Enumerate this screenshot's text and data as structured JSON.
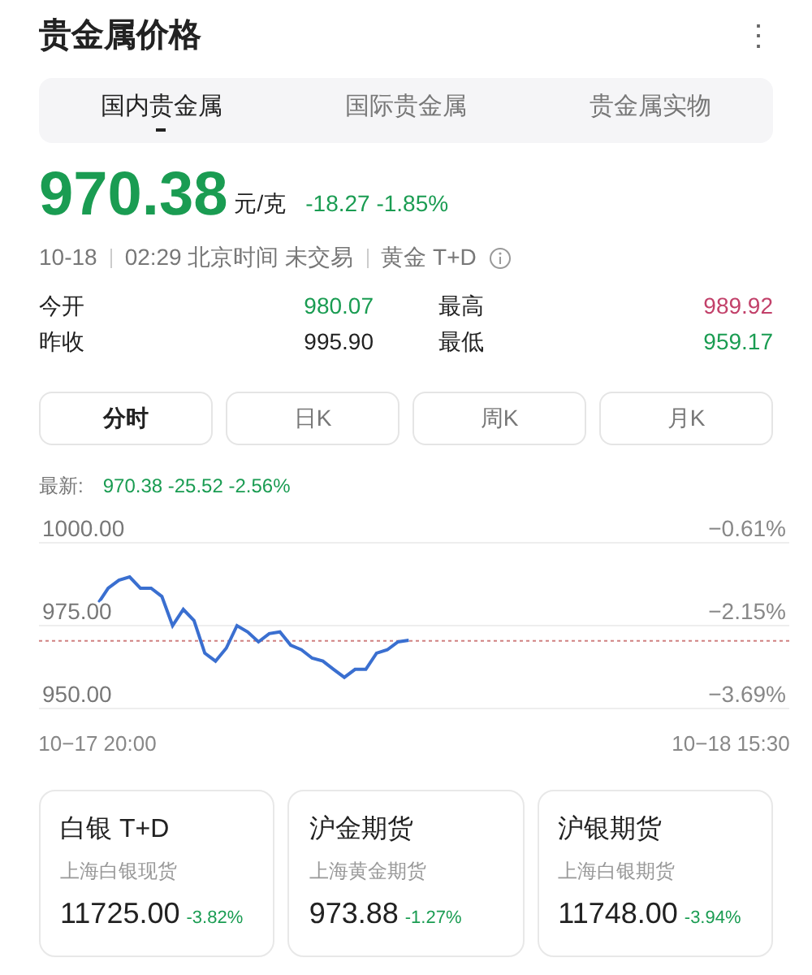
{
  "header": {
    "title": "贵金属价格",
    "menu": "⋮"
  },
  "tabs": [
    {
      "label": "国内贵金属",
      "selected": true
    },
    {
      "label": "国际贵金属",
      "selected": false
    },
    {
      "label": "贵金属实物",
      "selected": false
    }
  ],
  "quote": {
    "price": "970.38",
    "unit": "元/克",
    "change": "-18.27 -1.85%",
    "date": "10-18",
    "time": "02:29 北京时间 未交易",
    "product": "黄金 T+D"
  },
  "stats": [
    {
      "label": "今开",
      "value": "980.07",
      "color": "#1a9c52"
    },
    {
      "label": "最高",
      "value": "989.92",
      "color": "#c2416a"
    },
    {
      "label": "昨收",
      "value": "995.90",
      "color": "#222222"
    },
    {
      "label": "最低",
      "value": "959.17",
      "color": "#1a9c52"
    }
  ],
  "periods": [
    {
      "label": "分时",
      "selected": true
    },
    {
      "label": "日K",
      "selected": false
    },
    {
      "label": "周K",
      "selected": false
    },
    {
      "label": "月K",
      "selected": false
    }
  ],
  "chart": {
    "latest_label": "最新:",
    "latest_value": "970.38 -25.52 -2.56%",
    "right_labels": [
      "−0.61%",
      "−2.15%",
      "−3.69%"
    ],
    "chart_data": {
      "type": "line",
      "categories": [
        "10−17 20:00",
        null,
        null,
        null,
        null,
        null,
        null,
        null,
        null,
        null,
        null,
        null,
        null,
        null,
        null,
        null,
        null,
        null,
        null,
        null,
        null,
        null,
        null,
        null,
        null,
        null,
        null,
        null,
        null,
        null,
        null,
        null,
        null,
        null,
        null,
        null,
        null,
        null,
        null,
        null,
        null,
        null,
        null,
        null,
        null,
        null,
        null,
        null,
        null,
        null,
        null,
        null,
        null,
        null,
        null,
        null,
        null,
        null,
        null,
        "10−18 15:30"
      ],
      "series": [
        {
          "color": "#3a6fd0",
          "values": [
            981.4,
            986.3,
            988.7,
            989.7,
            986.3,
            986.3,
            983.8,
            975,
            979.9,
            976.5,
            966.7,
            964.3,
            968.2,
            975,
            973.1,
            970.1,
            972.6,
            973.1,
            969.1,
            967.7,
            965.2,
            964.3,
            961.8,
            959.4,
            961.8,
            961.8,
            966.7,
            967.7,
            970.1,
            970.6,
            null,
            null,
            null,
            null,
            null,
            null,
            null,
            null,
            null,
            null,
            null,
            null,
            null,
            null,
            null,
            null,
            null,
            null,
            null,
            null,
            null,
            null,
            null,
            null,
            null,
            null,
            null,
            null,
            null,
            null
          ]
        }
      ],
      "ylim": [
        950,
        1000
      ],
      "grid": true,
      "ref_lines": [
        {
          "axis": "y",
          "value": 970.38,
          "color": "#d08080"
        }
      ],
      "yticks": [
        {
          "value": 950,
          "label": "950.00"
        },
        {
          "value": 975,
          "label": "975.00"
        },
        {
          "value": 1000,
          "label": "1000.00"
        }
      ]
    }
  },
  "cards": [
    {
      "name": "白银 T+D",
      "subtitle": "上海白银现货",
      "price": "11725.00",
      "change": "-3.82%"
    },
    {
      "name": "沪金期货",
      "subtitle": "上海黄金期货",
      "price": "973.88",
      "change": "-1.27%"
    },
    {
      "name": "沪银期货",
      "subtitle": "上海白银期货",
      "price": "11748.00",
      "change": "-3.94%"
    }
  ]
}
